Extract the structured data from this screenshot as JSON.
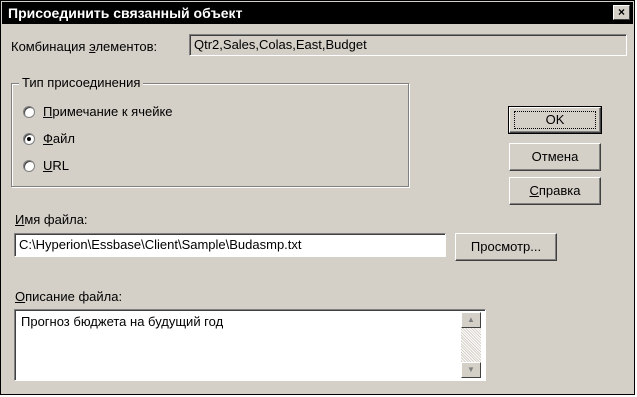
{
  "dialog": {
    "title": "Присоединить связанный объект",
    "close_glyph": "×"
  },
  "combination": {
    "label_pre": "Комбинация ",
    "label_mn": "э",
    "label_post": "лементов:",
    "value": "Qtr2,Sales,Colas,East,Budget"
  },
  "attach_type": {
    "group_title": "Тип присоединения",
    "options": [
      {
        "mn": "П",
        "rest": "римечание к ячейке",
        "checked": false
      },
      {
        "mn": "Ф",
        "rest": "айл",
        "checked": true
      },
      {
        "mn": "U",
        "rest": "RL",
        "checked": false
      }
    ]
  },
  "buttons": {
    "ok": "OK",
    "cancel": "Отмена",
    "help_mn": "С",
    "help_rest": "правка",
    "browse": "Просмотр..."
  },
  "file_name": {
    "label_mn": "И",
    "label_rest": "мя файла:",
    "value": "C:\\Hyperion\\Essbase\\Client\\Sample\\Budasmp.txt"
  },
  "file_description": {
    "label_mn": "О",
    "label_rest": "писание файла:",
    "value": "Прогноз бюджета на будущий год"
  },
  "icons": {
    "scroll_up": "▲",
    "scroll_down": "▼"
  }
}
